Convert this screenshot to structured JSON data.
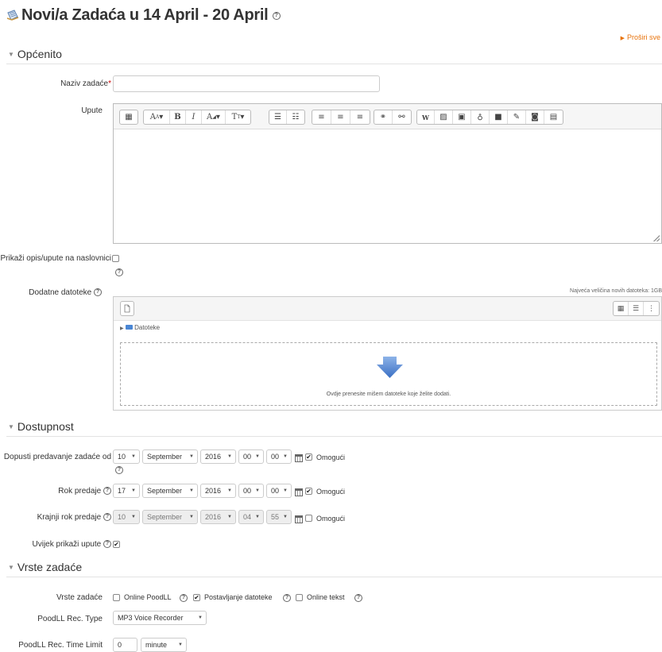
{
  "page": {
    "title_prefix": "Novi/a Zada",
    "title_suffix": "ća u 14 April - 20 April",
    "title_icon": "assignment-icon",
    "expand_all": "Proširi sve"
  },
  "sections": {
    "general": "Općenito",
    "availability": "Dostupnost",
    "submission_types": "Vrste zadaće"
  },
  "general": {
    "name_label": "Naziv zadaće",
    "name_required": "*",
    "name_value": "",
    "instructions_label": "Upute",
    "show_desc_label": "Prikaži opis/upute na naslovnici",
    "extra_files_label": "Dodatne datoteke",
    "max_size_text": "Najveća veličina novih datoteka: 1GB",
    "folder_label": "Datoteke",
    "drop_text": "Ovdje prenesite mišem datoteke koje želite dodati."
  },
  "editor_toolbar": [
    [
      "table-icon"
    ],
    [
      "font-family-icon",
      "bold-icon",
      "italic-icon",
      "font-color-icon",
      "font-size-icon"
    ],
    [
      "unordered-list-icon",
      "ordered-list-icon"
    ],
    [
      "align-left-icon",
      "align-center-icon",
      "align-right-icon"
    ],
    [
      "link-icon",
      "unlink-icon"
    ],
    [
      "word-paste-icon",
      "image-icon",
      "media-icon",
      "microphone-icon",
      "video-camera-icon",
      "pencil-icon",
      "camera-icon",
      "document-icon"
    ]
  ],
  "availability": {
    "enable_label": "Omogući",
    "rows": [
      {
        "label": "Dopusti predavanje zadaće od",
        "day": "10",
        "month": "September",
        "year": "2016",
        "hour": "00",
        "minute": "00",
        "enabled": true
      },
      {
        "label": "Rok predaje",
        "day": "17",
        "month": "September",
        "year": "2016",
        "hour": "00",
        "minute": "00",
        "enabled": true
      },
      {
        "label": "Krajnji rok predaje",
        "day": "10",
        "month": "September",
        "year": "2016",
        "hour": "04",
        "minute": "55",
        "enabled": false
      }
    ],
    "always_show_label": "Uvijek prikaži upute",
    "always_show_checked": true
  },
  "submission": {
    "types_label": "Vrste zadaće",
    "online_poodll": "Online PoodLL",
    "online_poodll_checked": false,
    "file_upload": "Postavljanje datoteke",
    "file_upload_checked": true,
    "online_text": "Online tekst",
    "online_text_checked": false,
    "rec_type_label": "PoodLL Rec. Type",
    "rec_type_value": "MP3 Voice Recorder",
    "time_limit_label": "PoodLL Rec. Time Limit",
    "time_limit_value": "0",
    "time_limit_unit": "minute"
  }
}
